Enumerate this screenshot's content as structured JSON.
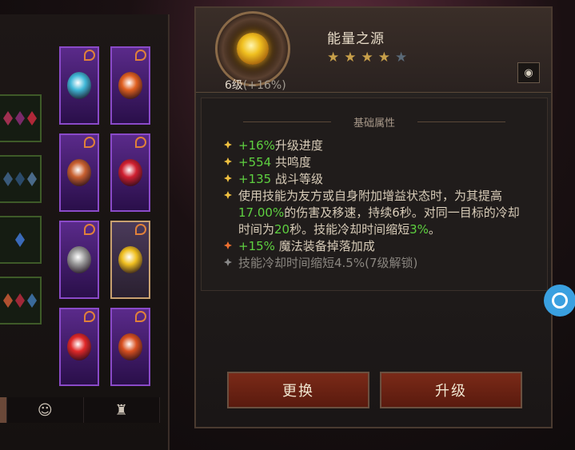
{
  "left_panel": {
    "gem_slots": [
      {
        "gems": [
          "#a03050",
          "#7a2a6a",
          "#b02838"
        ]
      },
      {
        "gems": [
          "#3a5a7a",
          "#2a4a6a",
          "#4a6a8a"
        ]
      },
      {
        "gems": [
          "#3a6ab8"
        ]
      },
      {
        "gems": [
          "#b05030",
          "#a02838",
          "#3a6a9a"
        ]
      }
    ],
    "cards": [
      {
        "orb_color": "#40b8d8",
        "selected": false
      },
      {
        "orb_color": "#e06020",
        "selected": false
      },
      {
        "orb_color": "#c86030",
        "selected": false
      },
      {
        "orb_color": "#d02030",
        "selected": false
      },
      {
        "orb_color": "#9a9a9a",
        "selected": false
      },
      {
        "orb_color": "#f0c020",
        "selected": true
      },
      {
        "orb_color": "#e02828",
        "selected": false
      },
      {
        "orb_color": "#d85020",
        "selected": false
      }
    ],
    "tabs": [
      {
        "icon": "accent-strip",
        "label": ""
      },
      {
        "icon": "character-portrait-icon",
        "label": "☺"
      },
      {
        "icon": "helmet-icon",
        "label": "♜"
      }
    ]
  },
  "detail": {
    "item_name": "能量之源",
    "stars_filled": 4,
    "stars_total": 5,
    "level": "6级",
    "level_bonus": "(+16%)",
    "eye_icon": "eye-icon",
    "section_title": "基础属性",
    "stats": [
      {
        "bullet": "yellow",
        "parts": [
          {
            "t": "+16%",
            "c": "green"
          },
          {
            "t": "升级进度",
            "c": ""
          }
        ]
      },
      {
        "bullet": "yellow",
        "parts": [
          {
            "t": "+554",
            "c": "green"
          },
          {
            "t": " 共鸣度",
            "c": ""
          }
        ]
      },
      {
        "bullet": "yellow",
        "parts": [
          {
            "t": "+135",
            "c": "green"
          },
          {
            "t": " 战斗等级",
            "c": ""
          }
        ]
      },
      {
        "bullet": "yellow",
        "parts": [
          {
            "t": "使用技能为友方或自身附加增益状态时，为其提高",
            "c": ""
          },
          {
            "t": "17.00%",
            "c": "green"
          },
          {
            "t": "的伤害及移速，持续6秒。对同一目标的冷却时间为",
            "c": ""
          },
          {
            "t": "20",
            "c": "green"
          },
          {
            "t": "秒。技能冷却时间缩短",
            "c": ""
          },
          {
            "t": "3%",
            "c": "green"
          },
          {
            "t": "。",
            "c": ""
          }
        ]
      },
      {
        "bullet": "red",
        "parts": [
          {
            "t": "+15%",
            "c": "green"
          },
          {
            "t": " 魔法装备掉落加成",
            "c": ""
          }
        ]
      },
      {
        "bullet": "grey",
        "parts": [
          {
            "t": "技能冷却时间缩短4.5%(7级解锁)",
            "c": "locked"
          }
        ]
      }
    ],
    "buttons": {
      "swap": "更换",
      "upgrade": "升级"
    }
  },
  "floating": {
    "chat_icon": "chat-bubble-icon"
  }
}
